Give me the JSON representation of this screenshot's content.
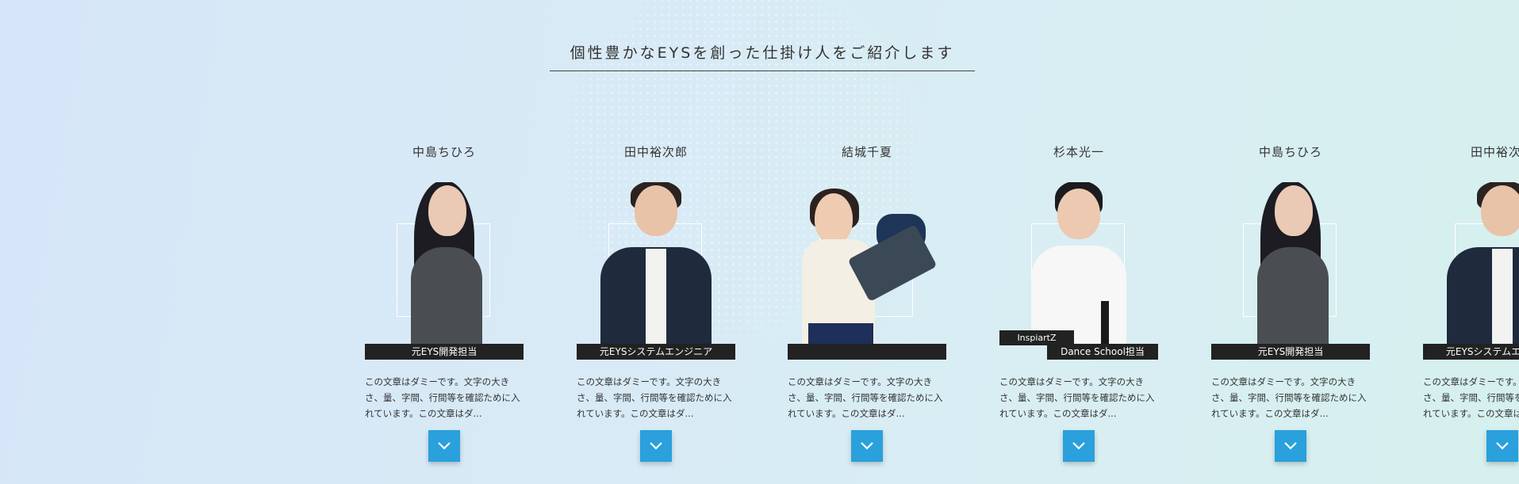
{
  "section": {
    "title": "個性豊かなEYSを創った仕掛け人をご紹介します"
  },
  "members": [
    {
      "name": "中島ちひろ",
      "role": "元EYS開発担当",
      "org": "",
      "description": "この文章はダミーです。文字の大きさ、量、字間、行間等を確認ために入れています。この文章はダ..."
    },
    {
      "name": "田中裕次郎",
      "role": "元EYSシステムエンジニア",
      "org": "",
      "description": "この文章はダミーです。文字の大きさ、量、字間、行間等を確認ために入れています。この文章はダ..."
    },
    {
      "name": "結城千夏",
      "role": "",
      "org": "",
      "description": "この文章はダミーです。文字の大きさ、量、字間、行間等を確認ために入れています。この文章はダ..."
    },
    {
      "name": "杉本光一",
      "role": "Dance School担当",
      "org": "InspiartZ",
      "description": "この文章はダミーです。文字の大きさ、量、字間、行間等を確認ために入れています。この文章はダ..."
    },
    {
      "name": "中島ちひろ",
      "role": "元EYS開発担当",
      "org": "",
      "description": "この文章はダミーです。文字の大きさ、量、字間、行間等を確認ために入れています。この文章はダ..."
    },
    {
      "name": "田中裕次郎",
      "role": "元EYSシステムエンジニア",
      "org": "",
      "description": "この文章はダミーです。文字の大きさ、量、字間、行間等を確認ために入れています。この文章はダ..."
    }
  ],
  "icons": {
    "more_button": "chevron-down-icon",
    "background": "globe-dots"
  },
  "colors": {
    "accent": "#2aa0dc",
    "role_bar": "#222222",
    "background_start": "#d6e6f8",
    "background_end": "#d5f0ee"
  }
}
